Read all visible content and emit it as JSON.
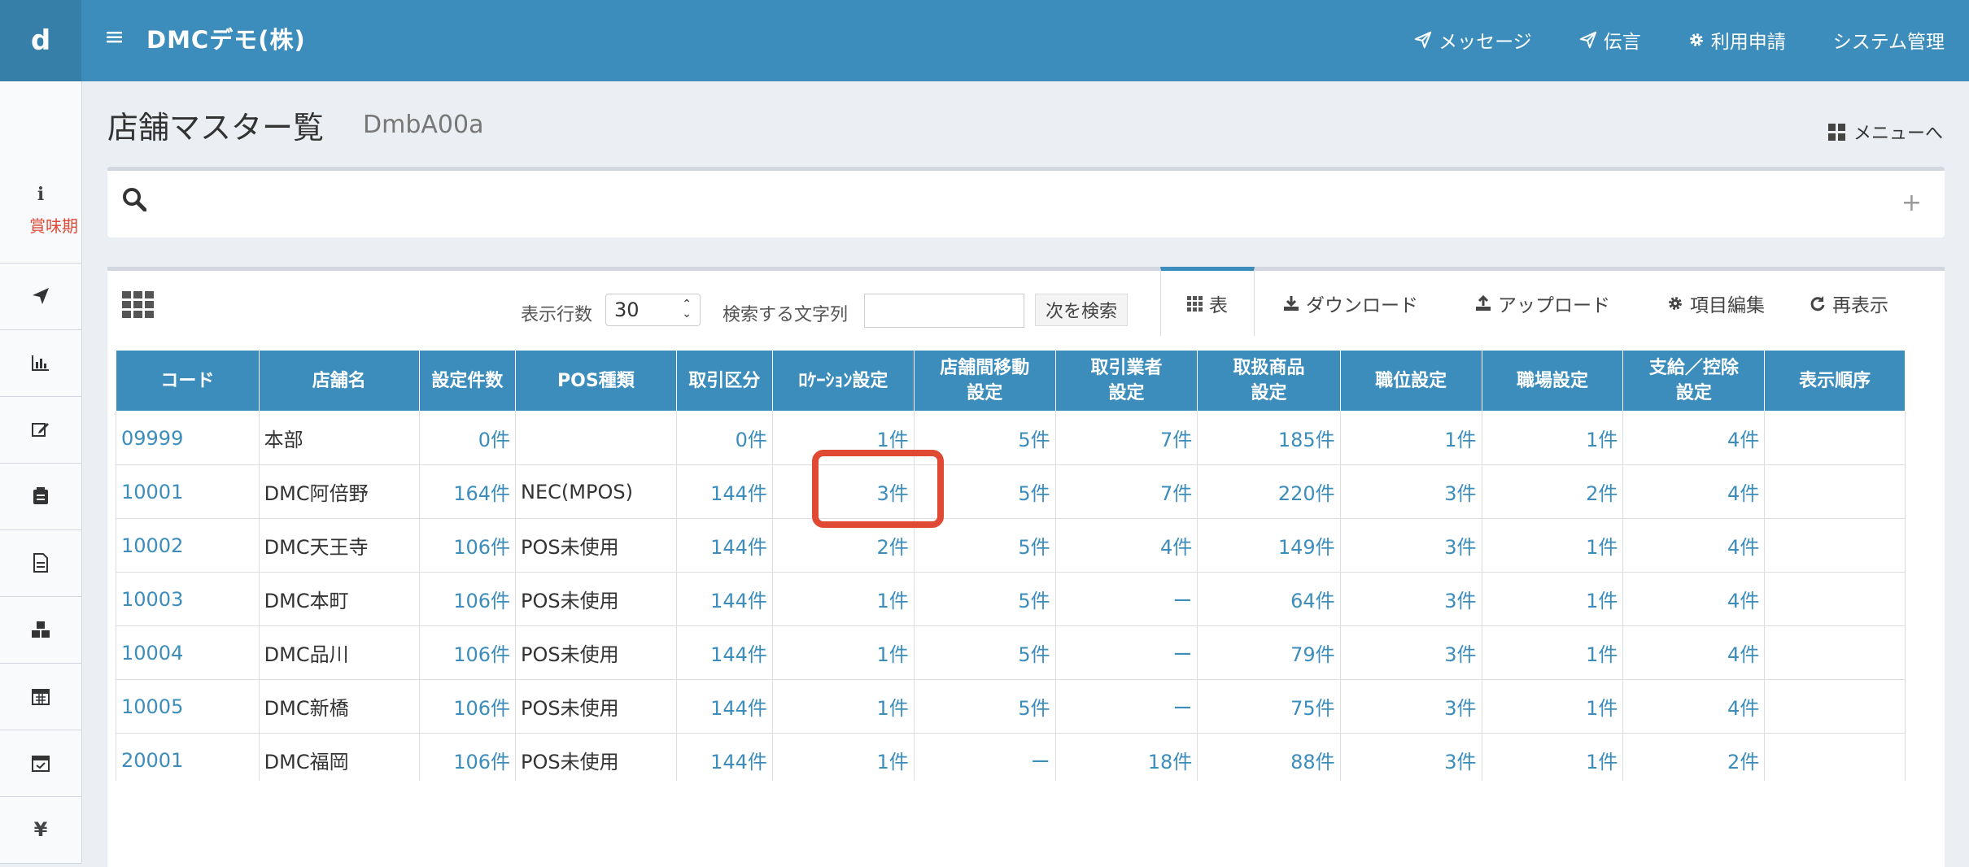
{
  "header": {
    "brand": "d",
    "company": "DMCデモ(株)",
    "nav": [
      {
        "icon": "paper-plane-icon",
        "label": "メッセージ"
      },
      {
        "icon": "paper-plane-icon",
        "label": "伝言"
      },
      {
        "icon": "gear-icon",
        "label": "利用申請"
      },
      {
        "icon": "",
        "label": "システム管理"
      }
    ]
  },
  "sidebar": {
    "info_label": "賞味期",
    "items": [
      "paper-plane-icon",
      "bar-chart-icon",
      "edit-icon",
      "clipboard-icon",
      "document-icon",
      "cubes-icon",
      "calendar-icon",
      "calendar-check-icon",
      "yen-icon"
    ]
  },
  "page": {
    "title": "店舗マスター覧",
    "code": "DmbA00a",
    "menu_link": "メニューへ"
  },
  "toolbar": {
    "rows_label": "表示行数",
    "rows_value": "30",
    "search_label": "検索する文字列",
    "search_value": "",
    "next_search": "次を検索",
    "tabs": [
      {
        "icon": "table-icon",
        "label": "表"
      },
      {
        "icon": "download-icon",
        "label": "ダウンロード"
      },
      {
        "icon": "upload-icon",
        "label": "アップロード"
      },
      {
        "icon": "gear-icon",
        "label": "項目編集"
      },
      {
        "icon": "refresh-icon",
        "label": "再表示"
      }
    ]
  },
  "table": {
    "headers": [
      "コード",
      "店舗名",
      "設定件数",
      "POS種類",
      "取引区分",
      "ﾛｹｰｼｮﾝ設定",
      "店舗間移動\n設定",
      "取引業者\n設定",
      "取扱商品\n設定",
      "職位設定",
      "職場設定",
      "支給／控除\n設定",
      "表示順序"
    ],
    "rows": [
      [
        "09999",
        "本部",
        "0件",
        "",
        "0件",
        "1件",
        "5件",
        "7件",
        "185件",
        "1件",
        "1件",
        "4件",
        ""
      ],
      [
        "10001",
        "DMC阿倍野",
        "164件",
        "NEC(MPOS)",
        "144件",
        "3件",
        "5件",
        "7件",
        "220件",
        "3件",
        "2件",
        "4件",
        ""
      ],
      [
        "10002",
        "DMC天王寺",
        "106件",
        "POS未使用",
        "144件",
        "2件",
        "5件",
        "4件",
        "149件",
        "3件",
        "1件",
        "4件",
        ""
      ],
      [
        "10003",
        "DMC本町",
        "106件",
        "POS未使用",
        "144件",
        "1件",
        "5件",
        "ー",
        "64件",
        "3件",
        "1件",
        "4件",
        ""
      ],
      [
        "10004",
        "DMC品川",
        "106件",
        "POS未使用",
        "144件",
        "1件",
        "5件",
        "ー",
        "79件",
        "3件",
        "1件",
        "4件",
        ""
      ],
      [
        "10005",
        "DMC新橋",
        "106件",
        "POS未使用",
        "144件",
        "1件",
        "5件",
        "ー",
        "75件",
        "3件",
        "1件",
        "4件",
        ""
      ],
      [
        "20001",
        "DMC福岡",
        "106件",
        "POS未使用",
        "144件",
        "1件",
        "ー",
        "18件",
        "88件",
        "3件",
        "1件",
        "2件",
        ""
      ]
    ]
  }
}
